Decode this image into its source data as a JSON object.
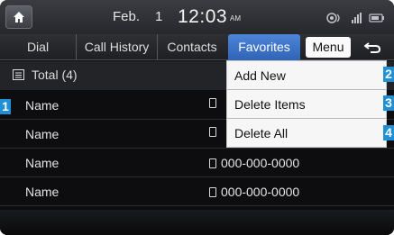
{
  "status_bar": {
    "date": "Feb.",
    "day": "1",
    "time": "12:03",
    "ampm": "AM"
  },
  "tabs": [
    {
      "label": "Dial"
    },
    {
      "label": "Call History"
    },
    {
      "label": "Contacts"
    },
    {
      "label": "Favorites",
      "active": true
    }
  ],
  "menu_button": "Menu",
  "total_label": "Total (4)",
  "favorites": [
    {
      "name": "Name",
      "phone": ""
    },
    {
      "name": "Name",
      "phone": ""
    },
    {
      "name": "Name",
      "phone": "000-000-0000"
    },
    {
      "name": "Name",
      "phone": "000-000-0000"
    }
  ],
  "menu_items": [
    {
      "label": "Add New",
      "callout": "2"
    },
    {
      "label": "Delete Items",
      "callout": "3"
    },
    {
      "label": "Delete All",
      "callout": "4"
    }
  ],
  "row_callout": "1",
  "colors": {
    "active_tab": "#3a73c9",
    "callout": "#1f8fd6",
    "background": "#0d0d0f"
  }
}
